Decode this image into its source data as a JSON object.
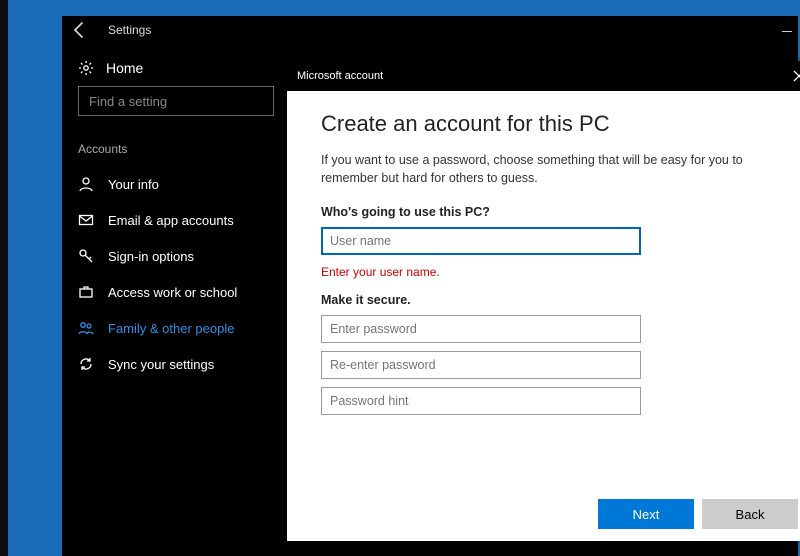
{
  "settings": {
    "title": "Settings",
    "home": "Home",
    "search_placeholder": "Find a setting",
    "section": "Accounts",
    "nav": [
      {
        "label": "Your info"
      },
      {
        "label": "Email & app accounts"
      },
      {
        "label": "Sign-in options"
      },
      {
        "label": "Access work or school"
      },
      {
        "label": "Family & other people"
      },
      {
        "label": "Sync your settings"
      }
    ]
  },
  "dialog": {
    "title": "Microsoft account",
    "heading": "Create an account for this PC",
    "intro": "If you want to use a password, choose something that will be easy for you to remember but hard for others to guess.",
    "username_label": "Who's going to use this PC?",
    "username_placeholder": "User name",
    "username_error": "Enter your user name.",
    "secure_label": "Make it secure.",
    "pw_placeholder": "Enter password",
    "repw_placeholder": "Re-enter password",
    "hint_placeholder": "Password hint",
    "next": "Next",
    "back": "Back"
  }
}
